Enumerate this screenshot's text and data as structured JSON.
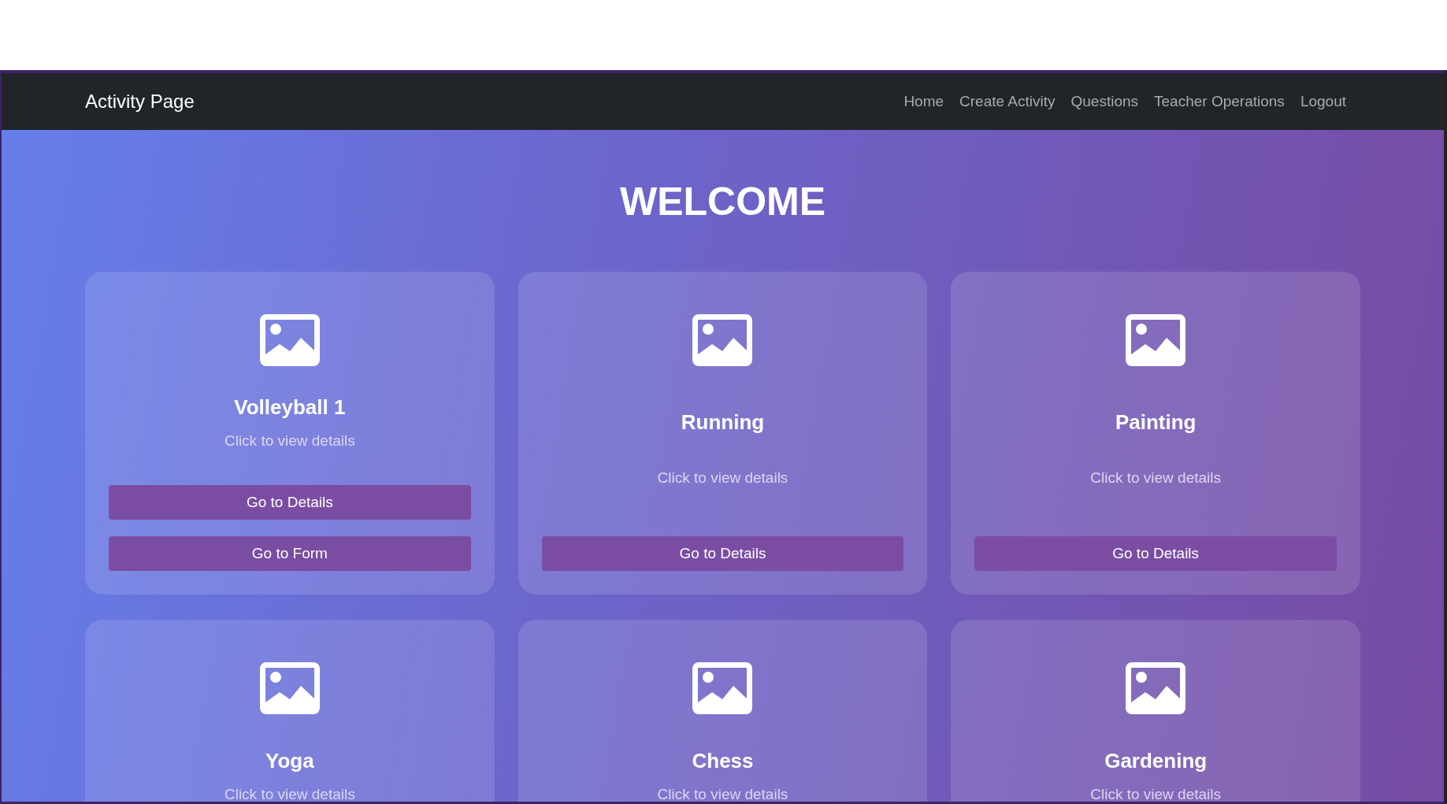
{
  "navbar": {
    "brand": "Activity Page",
    "links": [
      "Home",
      "Create Activity",
      "Questions",
      "Teacher Operations",
      "Logout"
    ]
  },
  "heading": "WELCOME",
  "cards": [
    {
      "title": "Volleyball 1",
      "subtitle": "Click to view details",
      "buttons": [
        "Go to Details",
        "Go to Form"
      ]
    },
    {
      "title": "Running",
      "subtitle": "Click to view details",
      "buttons": [
        "Go to Details"
      ]
    },
    {
      "title": "Painting",
      "subtitle": "Click to view details",
      "buttons": [
        "Go to Details"
      ]
    },
    {
      "title": "Yoga",
      "subtitle": "Click to view details"
    },
    {
      "title": "Chess",
      "subtitle": "Click to view details"
    },
    {
      "title": "Gardening",
      "subtitle": "Click to view details"
    }
  ]
}
